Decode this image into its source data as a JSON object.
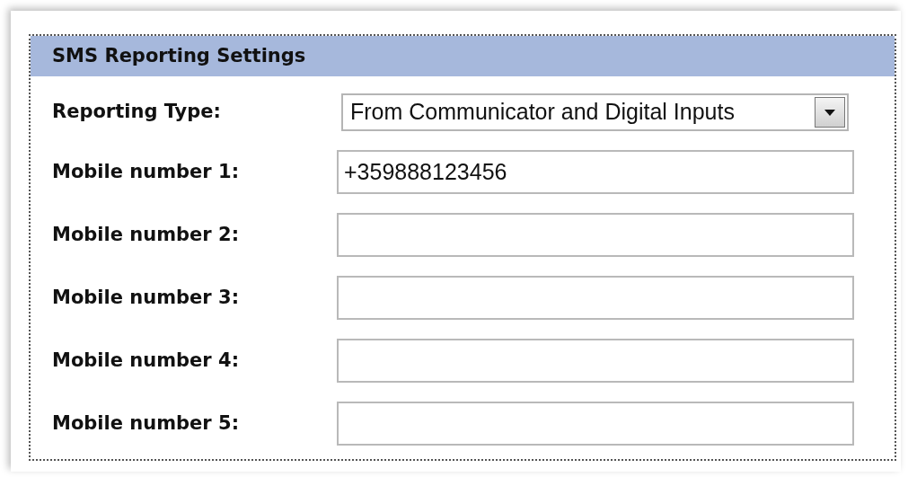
{
  "section": {
    "title": "SMS Reporting Settings"
  },
  "fields": [
    {
      "kind": "dropdown",
      "label": "Reporting Type:",
      "value": "From Communicator and Digital Inputs"
    },
    {
      "kind": "text",
      "label": "Mobile number 1:",
      "value": "+359888123456"
    },
    {
      "kind": "text",
      "label": "Mobile number 2:"
    },
    {
      "kind": "text",
      "label": "Mobile number 3:"
    },
    {
      "kind": "text",
      "label": "Mobile number 4:"
    },
    {
      "kind": "text",
      "label": "Mobile number 5:"
    }
  ]
}
